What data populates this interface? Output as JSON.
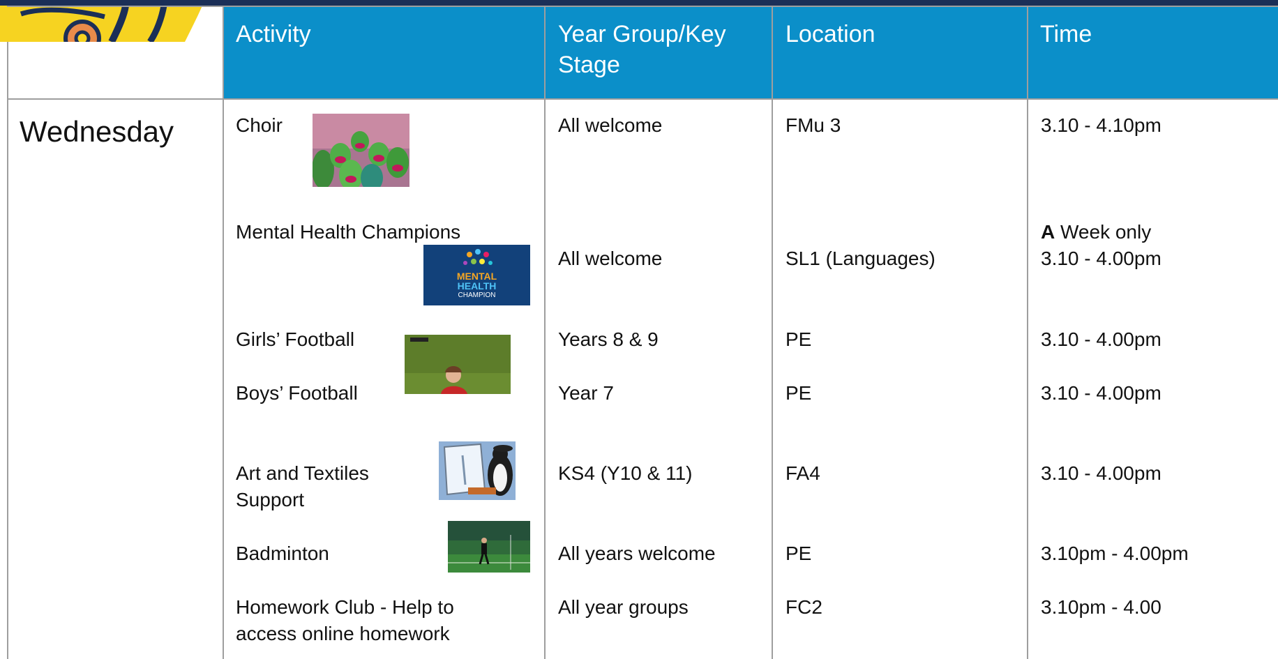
{
  "header": {
    "col_activity": "Activity",
    "col_year_line1": "Year Group/Key",
    "col_year_line2": "Stage",
    "col_location": "Location",
    "col_time": "Time"
  },
  "day": "Wednesday",
  "rows": [
    {
      "activity": "Choir",
      "year": "All welcome",
      "location": "FMu 3",
      "time": "3.10 - 4.10pm"
    },
    {
      "activity": "Mental Health Champions",
      "year": "All welcome",
      "location": "SL1 (Languages)",
      "time_bold": "A",
      "time_line1": " Week only",
      "time": "3.10 - 4.00pm"
    },
    {
      "activity": "Girls’ Football",
      "year": "Years 8 & 9",
      "location": "PE",
      "time": "3.10 - 4.00pm"
    },
    {
      "activity": "Boys’ Football",
      "year": "Year 7",
      "location": "PE",
      "time": "3.10 - 4.00pm"
    },
    {
      "activity_line1": "Art and Textiles",
      "activity_line2": "Support",
      "year": "KS4 (Y10 & 11)",
      "location": "FA4",
      "time": "3.10 - 4.00pm"
    },
    {
      "activity": "Badminton",
      "year": "All years welcome",
      "location": "PE",
      "time": "3.10pm - 4.00pm"
    },
    {
      "activity_line1": "Homework Club - Help to",
      "activity_line2": "access online homework",
      "year": "All year groups",
      "location": "FC2",
      "time": "3.10pm - 4.00"
    }
  ],
  "badges": {
    "mh_line1": "MENTAL",
    "mh_line2": "HEALTH",
    "mh_line3": "CHAMPION"
  },
  "colors": {
    "header_bg": "#0b8fc9",
    "top_bar": "#1b2f57",
    "grid_line": "#9e9e9e"
  }
}
